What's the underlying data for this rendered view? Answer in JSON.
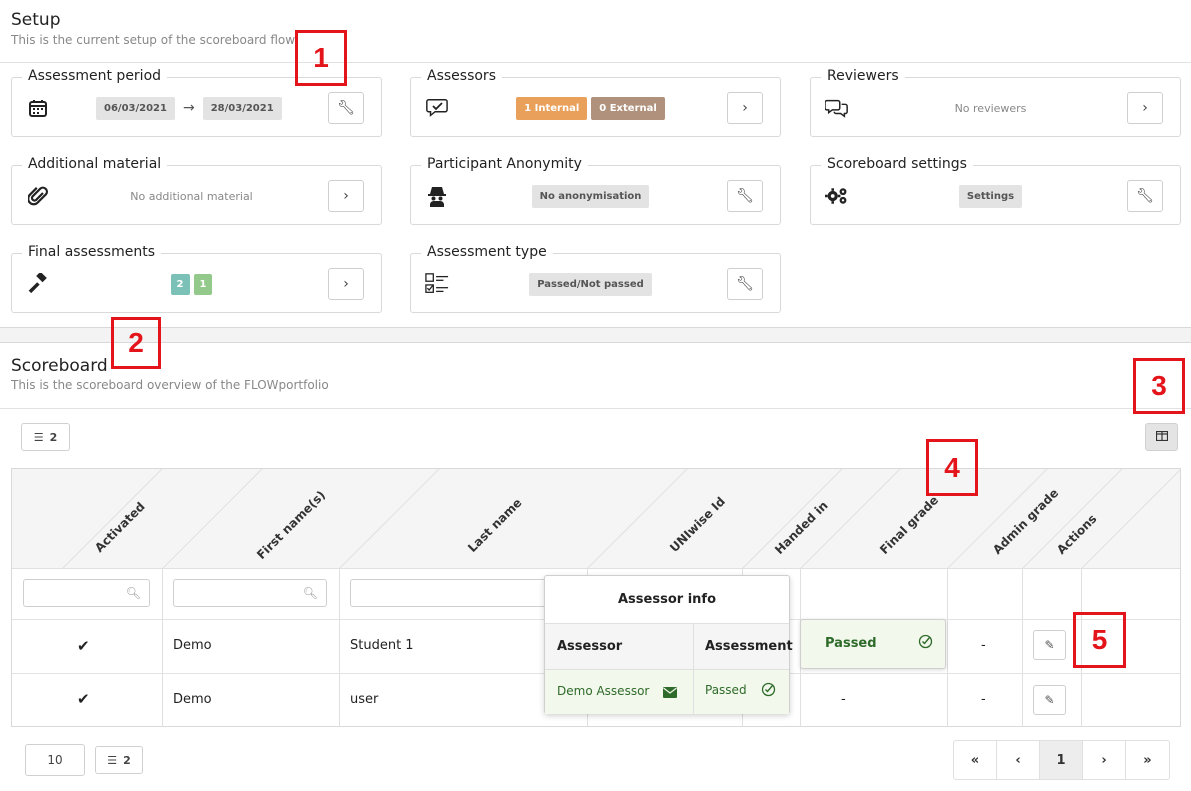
{
  "setup": {
    "title": "Setup",
    "subtitle": "This is the current setup of the scoreboard flow"
  },
  "cards": {
    "assessment_period": {
      "title": "Assessment period",
      "icon": "calendar-icon",
      "start": "06/03/2021",
      "end": "28/03/2021",
      "button_icon": "wrench-icon"
    },
    "assessors": {
      "title": "Assessors",
      "icon": "chat-check-icon",
      "internal": "1 Internal",
      "external": "0 External",
      "button_icon": "chevron-right-icon"
    },
    "reviewers": {
      "title": "Reviewers",
      "icon": "chat-bubbles-icon",
      "value": "No reviewers",
      "button_icon": "chevron-right-icon"
    },
    "additional_material": {
      "title": "Additional material",
      "icon": "paperclip-icon",
      "value": "No additional material",
      "button_icon": "chevron-right-icon"
    },
    "participant_anonymity": {
      "title": "Participant Anonymity",
      "icon": "incognito-icon",
      "value": "No anonymisation",
      "button_icon": "wrench-icon"
    },
    "scoreboard_settings": {
      "title": "Scoreboard settings",
      "icon": "gears-icon",
      "value": "Settings",
      "button_icon": "wrench-icon"
    },
    "final_assessments": {
      "title": "Final assessments",
      "icon": "gavel-icon",
      "count_a": "2",
      "count_b": "1",
      "button_icon": "chevron-right-icon"
    },
    "assessment_type": {
      "title": "Assessment type",
      "icon": "checklist-icon",
      "value": "Passed/Not passed",
      "button_icon": "wrench-icon"
    }
  },
  "scoreboard": {
    "title": "Scoreboard",
    "subtitle": "This is the scoreboard overview of the FLOWportfolio",
    "list_count": "2",
    "columns_toggle_icon": "columns-icon"
  },
  "table": {
    "headers": [
      "Activated",
      "First name(s)",
      "Last name",
      "UNIwise Id",
      "Handed in",
      "Final grade",
      "Admin grade",
      "Actions"
    ],
    "rows": [
      {
        "activated": "✔",
        "first_name": "Demo",
        "last_name": "Student 1",
        "final_grade": "Passed",
        "admin_grade": "-"
      },
      {
        "activated": "✔",
        "first_name": "Demo",
        "last_name": "user",
        "final_grade": "-",
        "admin_grade": "-"
      }
    ]
  },
  "popup": {
    "title": "Assessor info",
    "col_assessor": "Assessor",
    "col_assessment": "Assessment",
    "assessor_name": "Demo Assessor",
    "assessment_value": "Passed"
  },
  "footer": {
    "page_size": "10",
    "list_count": "2",
    "pager": [
      "«",
      "‹",
      "1",
      "›",
      "»"
    ]
  },
  "annotations": [
    "1",
    "2",
    "3",
    "4",
    "5"
  ],
  "colors": {
    "annotation_red": "#e4141b",
    "passed_green": "#2e6b2a",
    "internal_orange": "#e9a05a",
    "external_brown": "#b0927c"
  }
}
